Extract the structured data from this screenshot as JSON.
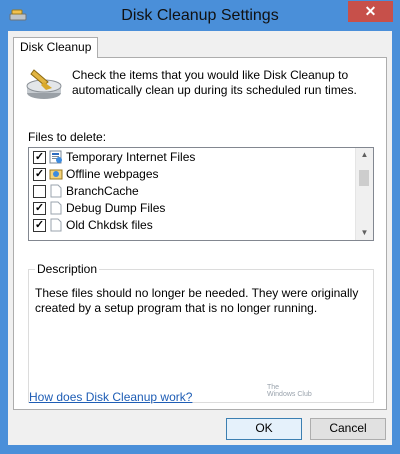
{
  "window": {
    "title": "Disk Cleanup Settings",
    "close_glyph": "✕"
  },
  "tab": {
    "label": "Disk Cleanup"
  },
  "intro": {
    "text": "Check the items that you would like Disk Cleanup to automatically clean up during its scheduled run times."
  },
  "files": {
    "label": "Files to delete:",
    "items": [
      {
        "label": "Temporary Internet Files",
        "checked": true,
        "check_glyph": "✓",
        "icon": "internet-files-icon"
      },
      {
        "label": "Offline webpages",
        "checked": true,
        "check_glyph": "✓",
        "icon": "offline-webpages-icon"
      },
      {
        "label": "BranchCache",
        "checked": false,
        "check_glyph": "",
        "icon": "file-icon"
      },
      {
        "label": "Debug Dump Files",
        "checked": true,
        "check_glyph": "✓",
        "icon": "file-icon"
      },
      {
        "label": "Old Chkdsk files",
        "checked": true,
        "check_glyph": "✓",
        "icon": "file-icon"
      }
    ]
  },
  "description": {
    "legend": "Description",
    "text": "These files should no longer be needed. They were originally created by a setup program that is no longer running.",
    "watermark_line1": "The",
    "watermark_line2": "Windows Club"
  },
  "help": {
    "link_text": "How does Disk Cleanup work?"
  },
  "buttons": {
    "ok": "OK",
    "cancel": "Cancel"
  },
  "colors": {
    "titlebar": "#4a8fd9",
    "close": "#c7504a",
    "link": "#1e5db5"
  }
}
